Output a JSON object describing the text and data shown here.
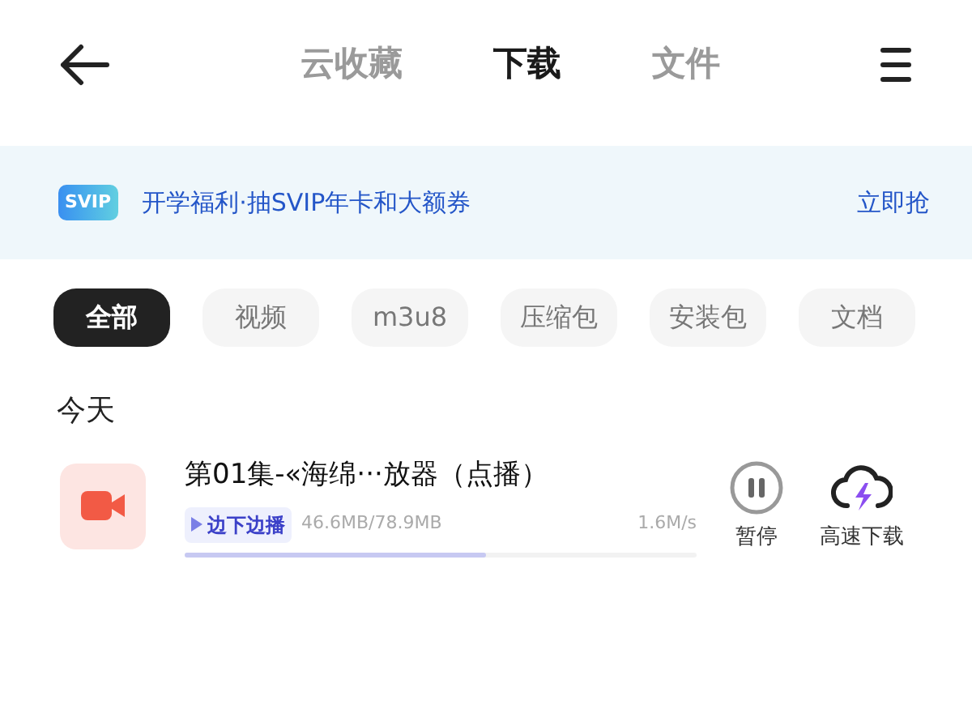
{
  "header": {
    "tabs": [
      {
        "label": "云收藏",
        "selected": false
      },
      {
        "label": "下载",
        "selected": true
      },
      {
        "label": "文件",
        "selected": false
      }
    ]
  },
  "banner": {
    "badge": "SVIP",
    "text": "开学福利·抽SVIP年卡和大额券",
    "action": "立即抢"
  },
  "filters": [
    {
      "label": "全部",
      "selected": true
    },
    {
      "label": "视频",
      "selected": false
    },
    {
      "label": "m3u8",
      "selected": false
    },
    {
      "label": "压缩包",
      "selected": false
    },
    {
      "label": "安装包",
      "selected": false
    },
    {
      "label": "文档",
      "selected": false
    }
  ],
  "section_title": "今天",
  "downloads": [
    {
      "title": "第01集-«海绵···放器（点播）",
      "tag": "边下边播",
      "size": "46.6MB/78.9MB",
      "speed": "1.6M/s",
      "level": 0.59,
      "pause_label": "暂停",
      "boost_label": "高速下载"
    }
  ]
}
